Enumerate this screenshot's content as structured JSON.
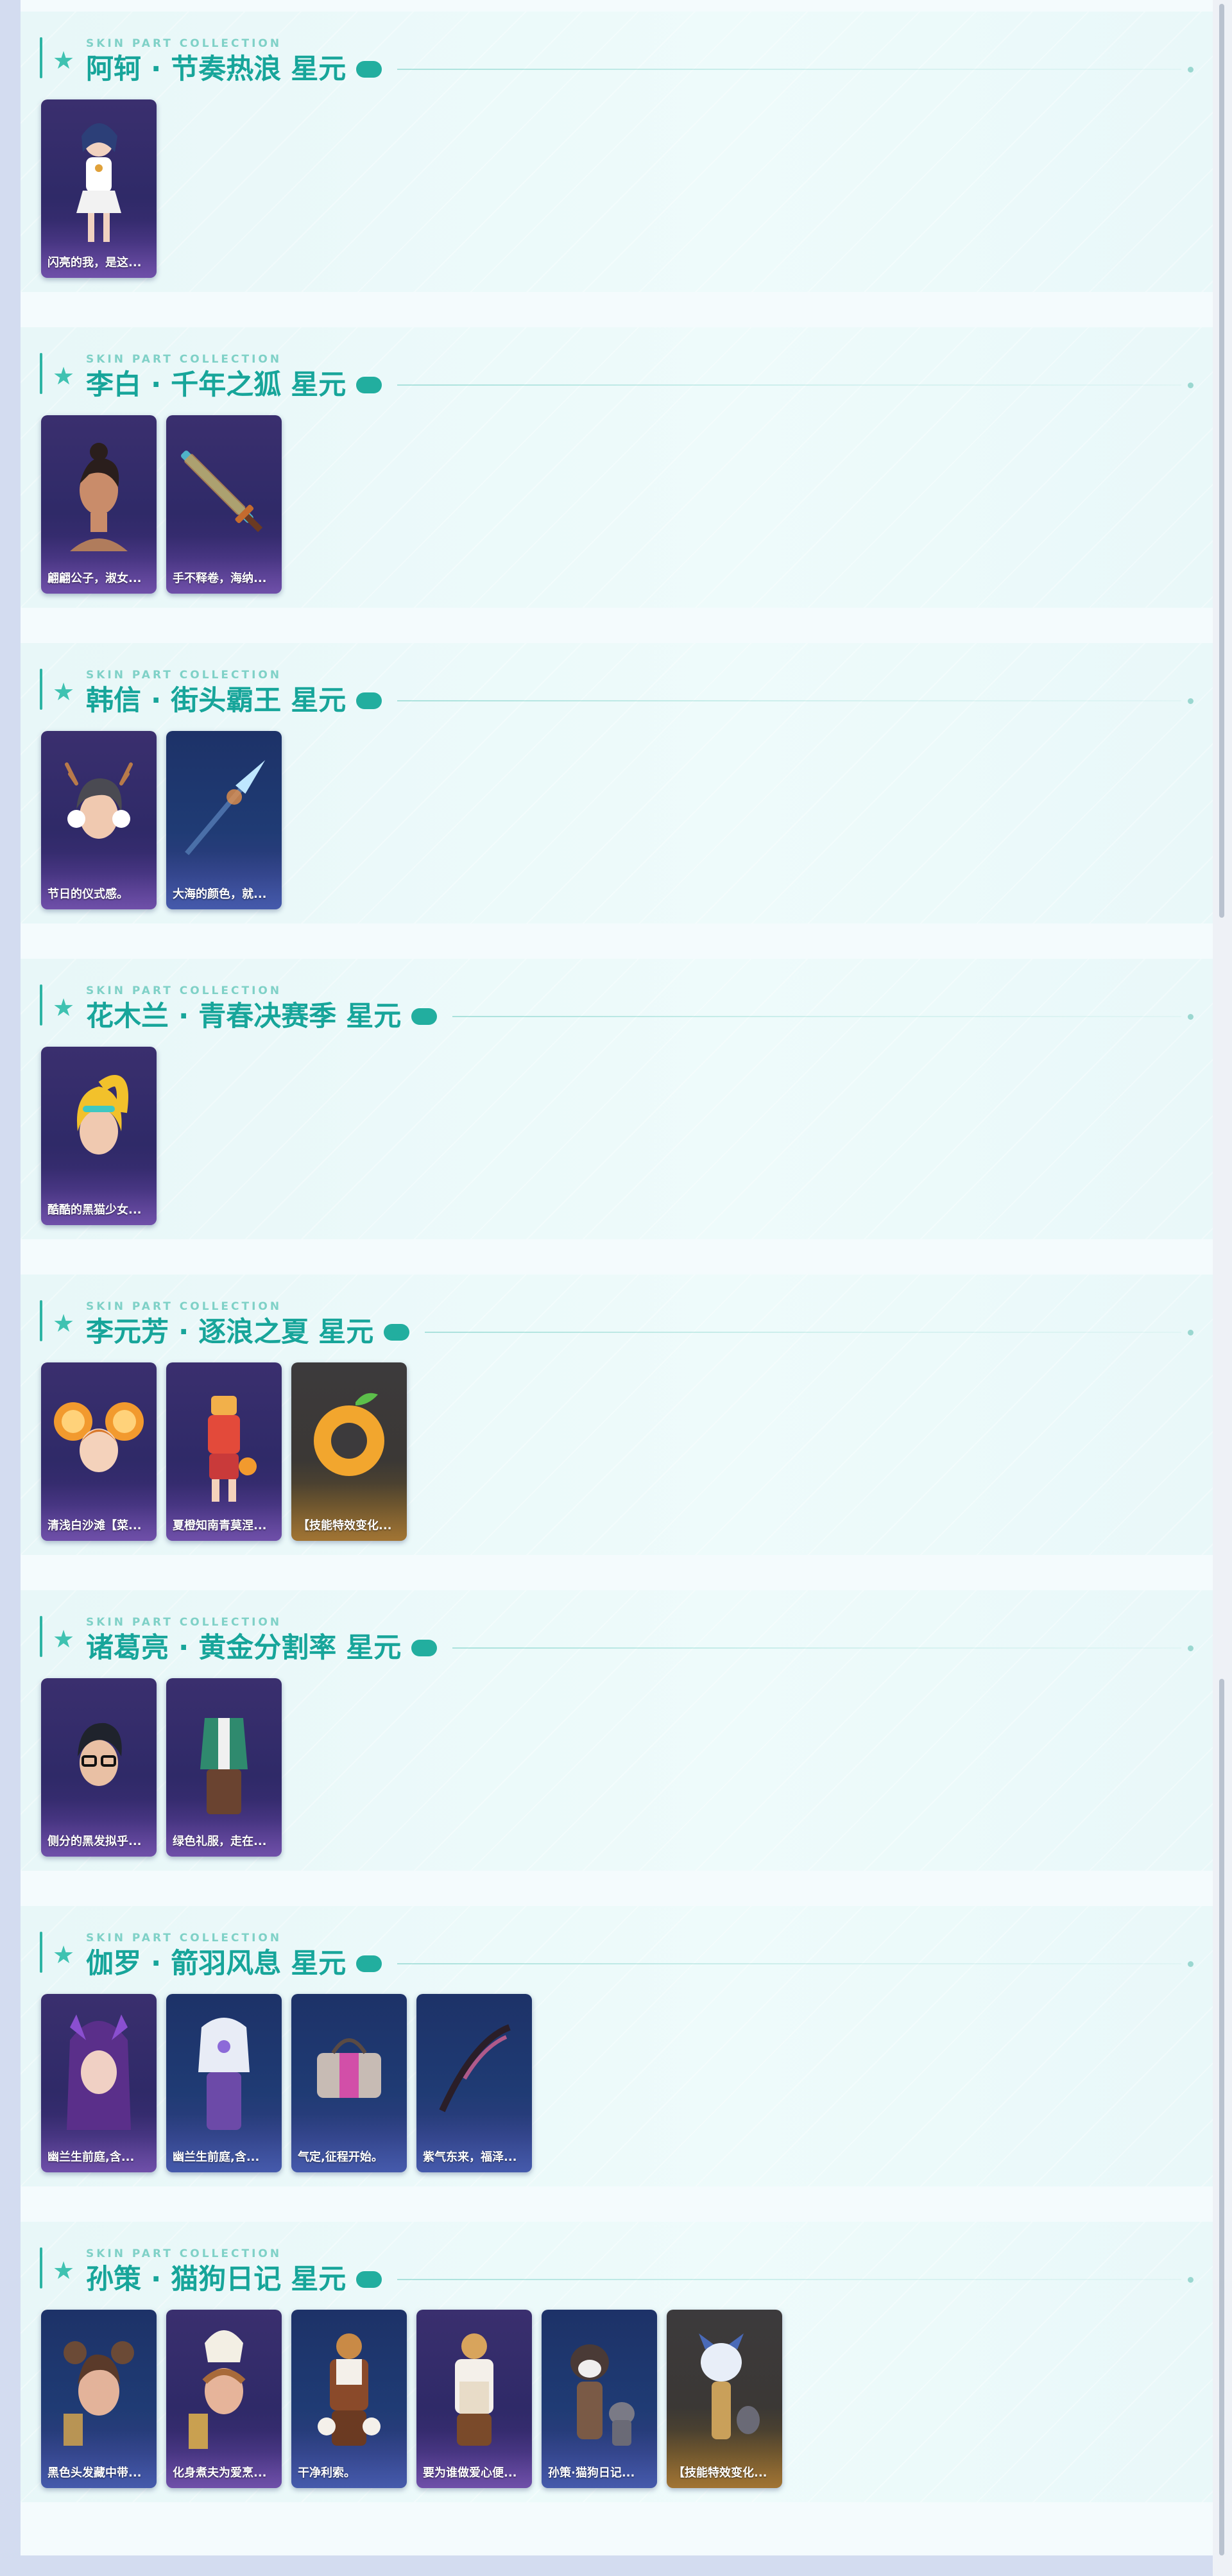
{
  "eyebrow": "SKIN PART COLLECTION",
  "colors": {
    "accent": "#17a59a",
    "pill": "#22ae9f",
    "background": "#f4fbfd"
  },
  "sections": [
    {
      "title": "阿轲 · 节奏热浪 星元",
      "cards": [
        {
          "caption": "闪亮的我，是这...",
          "tone": "purple",
          "icon": "girl-costume-icon"
        }
      ]
    },
    {
      "title": "李白 · 千年之狐 星元",
      "cards": [
        {
          "caption": "翩翩公子，淑女...",
          "tone": "purple",
          "icon": "man-head-icon"
        },
        {
          "caption": "手不释卷，海纳...",
          "tone": "purple",
          "icon": "sword-icon"
        }
      ]
    },
    {
      "title": "韩信 · 街头霸王 星元",
      "cards": [
        {
          "caption": "节日的仪式感。",
          "tone": "purple",
          "icon": "antler-head-icon"
        },
        {
          "caption": "大海的颜色，就...",
          "tone": "blue",
          "icon": "spear-icon"
        }
      ]
    },
    {
      "title": "花木兰 · 青春决赛季 星元",
      "cards": [
        {
          "caption": "酷酷的黑猫少女...",
          "tone": "purple",
          "icon": "blonde-head-icon"
        }
      ]
    },
    {
      "title": "李元芳 · 逐浪之夏 星元",
      "cards": [
        {
          "caption": "清浅白沙滩【菜...",
          "tone": "purple",
          "icon": "orange-head-icon"
        },
        {
          "caption": "夏橙知南青莫涅...",
          "tone": "purple",
          "icon": "summer-outfit-icon"
        },
        {
          "caption": "【技能特效变化...",
          "tone": "gold",
          "icon": "orange-ring-icon"
        }
      ]
    },
    {
      "title": "诸葛亮 · 黄金分割率 星元",
      "cards": [
        {
          "caption": "侧分的黑发拟乎...",
          "tone": "purple",
          "icon": "glasses-head-icon"
        },
        {
          "caption": "绿色礼服，走在...",
          "tone": "purple",
          "icon": "suit-outfit-icon"
        }
      ]
    },
    {
      "title": "伽罗 · 箭羽风息 星元",
      "cards": [
        {
          "caption": "幽兰生前庭,含...",
          "tone": "purple",
          "icon": "purple-hair-head-icon"
        },
        {
          "caption": "幽兰生前庭,含...",
          "tone": "blue",
          "icon": "white-armor-outfit-icon"
        },
        {
          "caption": "气定,征程开始。",
          "tone": "blue",
          "icon": "bag-icon"
        },
        {
          "caption": "紫气东来，福泽...",
          "tone": "blue",
          "icon": "bow-icon"
        }
      ]
    },
    {
      "title": "孙策 · 猫狗日记 星元",
      "cards": [
        {
          "caption": "黑色头发藏中带...",
          "tone": "blue",
          "icon": "bear-ear-head-icon"
        },
        {
          "caption": "化身煮夫为爱烹...",
          "tone": "purple",
          "icon": "chef-head-icon"
        },
        {
          "caption": "干净利索。",
          "tone": "blue",
          "icon": "overalls-outfit-icon"
        },
        {
          "caption": "要为谁做爱心便...",
          "tone": "purple",
          "icon": "apron-outfit-icon"
        },
        {
          "caption": "孙策·猫狗日记...",
          "tone": "blue",
          "icon": "dog-cat-icon"
        },
        {
          "caption": "【技能特效变化...",
          "tone": "gold",
          "icon": "dog-effect-icon"
        }
      ]
    }
  ]
}
